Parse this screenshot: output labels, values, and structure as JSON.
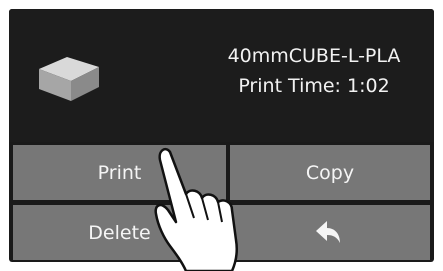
{
  "file": {
    "name": "40mmCUBE-L-PLA",
    "print_time": "Print Time: 1:02",
    "thumbnail_icon": "cube-icon"
  },
  "buttons": {
    "print_label": "Print",
    "copy_label": "Copy",
    "delete_label": "Delete",
    "back_icon": "back-arrow-icon"
  },
  "colors": {
    "screen_bg": "#1a1a1a",
    "button_bg": "#777777",
    "text": "#f2f2f2"
  }
}
